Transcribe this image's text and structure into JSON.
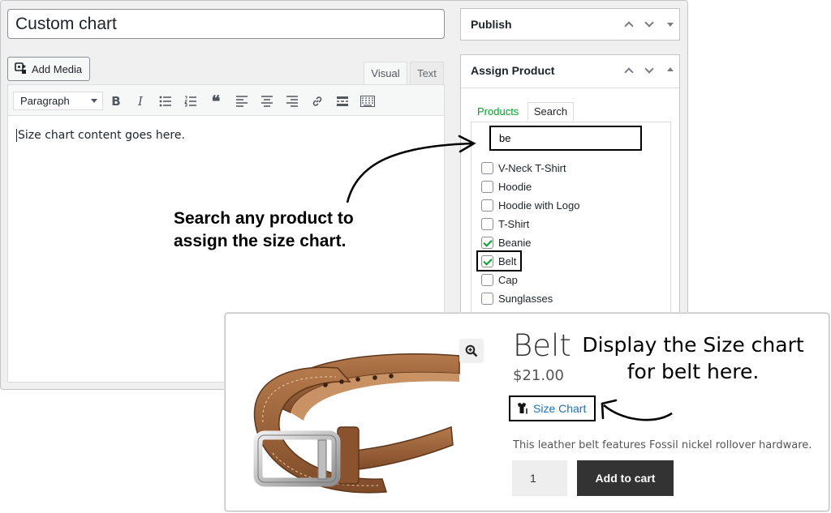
{
  "editor": {
    "title_value": "Custom chart",
    "add_media_label": "Add Media",
    "tab_visual": "Visual",
    "tab_text": "Text",
    "format_select": "Paragraph",
    "content": "Size chart content goes here.",
    "toolbar_icons": [
      "bold-icon",
      "italic-icon",
      "bullet-list-icon",
      "numbered-list-icon",
      "blockquote-icon",
      "align-left-icon",
      "align-center-icon",
      "align-right-icon",
      "link-icon",
      "read-more-icon",
      "toolbar-toggle-icon"
    ]
  },
  "publish_box": {
    "title": "Publish"
  },
  "assign_box": {
    "title": "Assign Product",
    "tab_products": "Products",
    "tab_search": "Search",
    "search_value": "be",
    "products": [
      {
        "label": "V-Neck T-Shirt",
        "checked": false
      },
      {
        "label": "Hoodie",
        "checked": false
      },
      {
        "label": "Hoodie with Logo",
        "checked": false
      },
      {
        "label": "T-Shirt",
        "checked": false
      },
      {
        "label": "Beanie",
        "checked": true
      },
      {
        "label": "Belt",
        "checked": true
      },
      {
        "label": "Cap",
        "checked": false
      },
      {
        "label": "Sunglasses",
        "checked": false
      }
    ]
  },
  "annotations": {
    "left_line1": "Search any product to",
    "left_line2": "assign the size chart.",
    "right_line1": "Display the Size chart",
    "right_line2": "for belt here."
  },
  "product": {
    "title": "Belt",
    "price": "$21.00",
    "size_chart_link": "Size Chart",
    "description": "This leather belt features Fossil nickel rollover hardware.",
    "quantity": "1",
    "add_to_cart": "Add to cart"
  },
  "colors": {
    "accent_green": "#00a32a",
    "link_blue": "#2271b1",
    "button_dark": "#333333"
  }
}
